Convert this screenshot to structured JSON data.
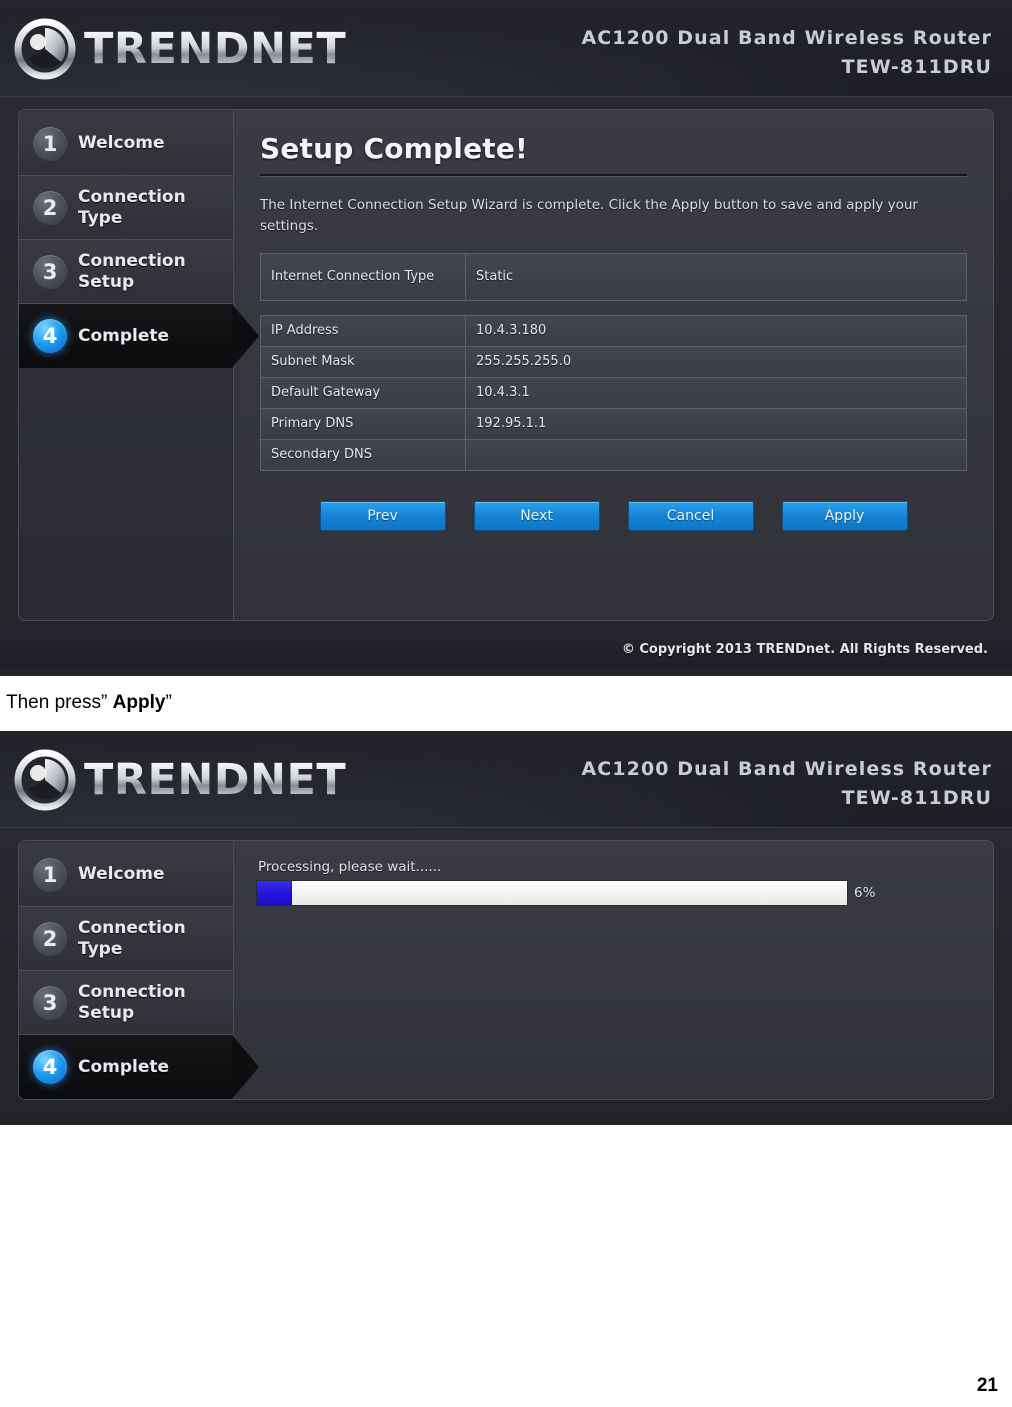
{
  "document": {
    "caption_prefix": "Then press” ",
    "caption_emphasis": "Apply",
    "caption_suffix": "”",
    "page_number": "21"
  },
  "router": {
    "brand": "TRENDnET",
    "brand_logo_icon": "trendnet-circle-logo-icon",
    "product_name": "AC1200 Dual Band Wireless Router",
    "model": "TEW-811DRU",
    "copyright": "© Copyright 2013 TRENDnet. All Rights Reserved."
  },
  "steps": [
    {
      "number": "1",
      "label": "Welcome",
      "active": false
    },
    {
      "number": "2",
      "label": "Connection\nType",
      "active": false
    },
    {
      "number": "3",
      "label": "Connection\nSetup",
      "active": false
    },
    {
      "number": "4",
      "label": "Complete",
      "active": true
    }
  ],
  "screen_complete": {
    "title": "Setup Complete!",
    "intro": "The Internet Connection Setup Wizard is complete. Click the Apply button to save and apply your settings.",
    "summary_primary": [
      {
        "key": "Internet Connection Type",
        "value": "Static"
      }
    ],
    "summary_details": [
      {
        "key": "IP Address",
        "value": "10.4.3.180"
      },
      {
        "key": "Subnet Mask",
        "value": "255.255.255.0"
      },
      {
        "key": "Default Gateway",
        "value": "10.4.3.1"
      },
      {
        "key": "Primary DNS",
        "value": "192.95.1.1"
      },
      {
        "key": "Secondary DNS",
        "value": ""
      }
    ],
    "buttons": [
      {
        "label": "Prev"
      },
      {
        "label": "Next"
      },
      {
        "label": "Cancel"
      },
      {
        "label": "Apply"
      }
    ]
  },
  "screen_processing": {
    "status_text": "Processing, please wait......",
    "progress_percent": 6,
    "progress_label": "6%"
  },
  "colors": {
    "accent_blue": "#1b8fe0",
    "progress_blue": "#2414e0",
    "panel_bg": "#33343c",
    "header_bg": "#22232a",
    "step_active_bg": "#0e0e11"
  }
}
